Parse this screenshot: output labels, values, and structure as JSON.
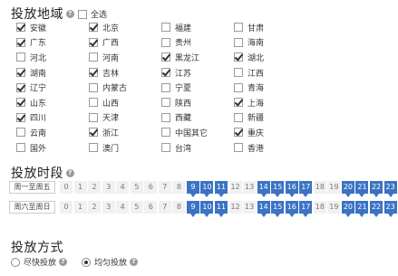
{
  "region_section": {
    "title": "投放地域",
    "select_all_label": "全选",
    "select_all_checked": false,
    "regions": [
      {
        "label": "安徽",
        "checked": true
      },
      {
        "label": "北京",
        "checked": true
      },
      {
        "label": "福建",
        "checked": false
      },
      {
        "label": "甘肃",
        "checked": false
      },
      {
        "label": "广东",
        "checked": true
      },
      {
        "label": "广西",
        "checked": true
      },
      {
        "label": "贵州",
        "checked": false
      },
      {
        "label": "海南",
        "checked": false
      },
      {
        "label": "河北",
        "checked": false
      },
      {
        "label": "河南",
        "checked": false
      },
      {
        "label": "黑龙江",
        "checked": true
      },
      {
        "label": "湖北",
        "checked": true
      },
      {
        "label": "湖南",
        "checked": true
      },
      {
        "label": "吉林",
        "checked": true
      },
      {
        "label": "江苏",
        "checked": true
      },
      {
        "label": "江西",
        "checked": false
      },
      {
        "label": "辽宁",
        "checked": true
      },
      {
        "label": "内蒙古",
        "checked": false
      },
      {
        "label": "宁夏",
        "checked": false
      },
      {
        "label": "青海",
        "checked": false
      },
      {
        "label": "山东",
        "checked": true
      },
      {
        "label": "山西",
        "checked": false
      },
      {
        "label": "陕西",
        "checked": false
      },
      {
        "label": "上海",
        "checked": true
      },
      {
        "label": "四川",
        "checked": true
      },
      {
        "label": "天津",
        "checked": false
      },
      {
        "label": "西藏",
        "checked": false
      },
      {
        "label": "新疆",
        "checked": false
      },
      {
        "label": "云南",
        "checked": false
      },
      {
        "label": "浙江",
        "checked": true
      },
      {
        "label": "中国其它",
        "checked": false
      },
      {
        "label": "重庆",
        "checked": true
      },
      {
        "label": "国外",
        "checked": false
      },
      {
        "label": "澳门",
        "checked": false
      },
      {
        "label": "台湾",
        "checked": false
      },
      {
        "label": "香港",
        "checked": false
      }
    ]
  },
  "time_section": {
    "title": "投放时段",
    "rows": [
      {
        "label": "周一至周五",
        "hours": [
          "0",
          "1",
          "2",
          "3",
          "4",
          "5",
          "6",
          "7",
          "8",
          "9",
          "10",
          "11",
          "12",
          "13",
          "14",
          "15",
          "16",
          "17",
          "18",
          "19",
          "20",
          "21",
          "22",
          "23"
        ],
        "selected": [
          9,
          10,
          11,
          14,
          15,
          16,
          17,
          20,
          21,
          22,
          23
        ]
      },
      {
        "label": "周六至周日",
        "hours": [
          "0",
          "1",
          "2",
          "3",
          "4",
          "5",
          "6",
          "7",
          "8",
          "9",
          "10",
          "11",
          "12",
          "13",
          "14",
          "15",
          "16",
          "17",
          "18",
          "19",
          "20",
          "21",
          "22",
          "23"
        ],
        "selected": [
          9,
          10,
          11,
          14,
          15,
          16,
          17,
          20,
          21,
          22,
          23
        ]
      }
    ]
  },
  "mode_section": {
    "title": "投放方式",
    "options": [
      {
        "label": "尽快投放",
        "selected": false
      },
      {
        "label": "均匀投放",
        "selected": true
      }
    ]
  },
  "colors": {
    "selected_hour": "#3b73c5"
  }
}
